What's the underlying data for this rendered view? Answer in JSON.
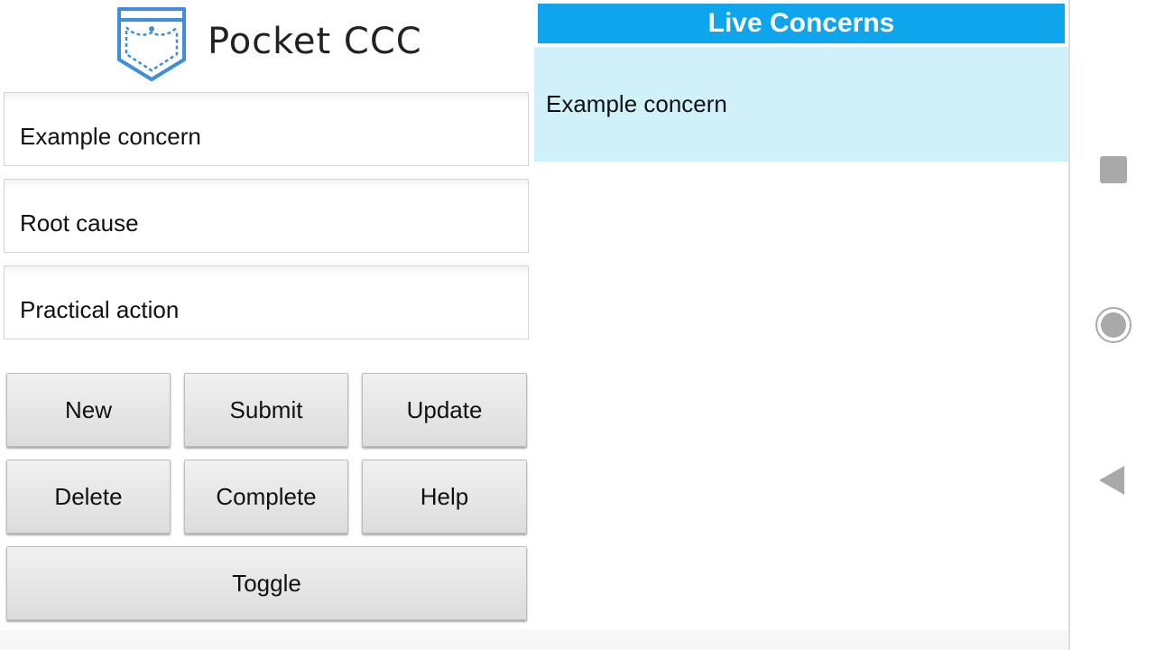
{
  "app": {
    "title": "Pocket CCC",
    "logo_icon": "pocket-icon",
    "accent_color": "#0ea5ec",
    "logo_color": "#3d8fdc"
  },
  "form": {
    "concern_value": "Example concern",
    "root_cause_value": "Root cause",
    "practical_action_value": "Practical action"
  },
  "buttons": {
    "new": "New",
    "submit": "Submit",
    "update": "Update",
    "delete": "Delete",
    "complete": "Complete",
    "help": "Help",
    "toggle": "Toggle"
  },
  "live_concerns": {
    "header": "Live Concerns",
    "items": [
      {
        "label": "Example concern",
        "highlight_color": "#d0f1f9"
      }
    ]
  },
  "nav_bar": {
    "recents_icon": "square-recents-icon",
    "home_icon": "circle-home-icon",
    "back_icon": "triangle-back-icon"
  }
}
